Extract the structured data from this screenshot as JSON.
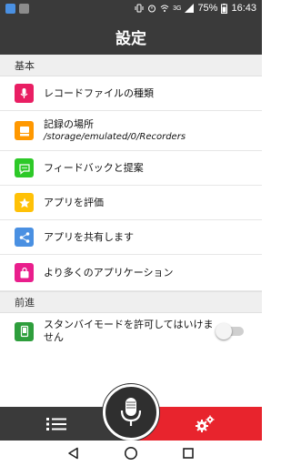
{
  "status_bar": {
    "network": "3G",
    "battery": "75%",
    "time": "16:43",
    "icons": [
      "notification-app-icon",
      "gallery-app-icon",
      "vibrate-icon",
      "alarm-icon",
      "wifi-icon",
      "signal-icon",
      "battery-icon"
    ]
  },
  "header": {
    "title": "設定"
  },
  "sections": [
    {
      "title": "基本",
      "items": [
        {
          "label": "レコードファイルの種類",
          "icon": "recorder-file-icon",
          "color": "#e91e63"
        },
        {
          "label": "記録の場所",
          "sub": "/storage/emulated/0/Recorders",
          "icon": "storage-drive-icon",
          "color": "#ff9800"
        },
        {
          "label": "フィードバックと提案",
          "icon": "chat-bubble-icon",
          "color": "#2dc928"
        },
        {
          "label": "アプリを評価",
          "icon": "star-icon",
          "color": "#ffc107"
        },
        {
          "label": "アプリを共有します",
          "icon": "share-icon",
          "color": "#4a90e2"
        },
        {
          "label": "より多くのアプリケーション",
          "icon": "shopping-bag-icon",
          "color": "#e91e8c"
        }
      ]
    },
    {
      "title": "前進",
      "items": [
        {
          "label": "スタンバイモードを許可してはいけません",
          "icon": "phone-screen-icon",
          "color": "#2e9e3c",
          "toggle": false
        }
      ]
    }
  ],
  "bottom_nav": {
    "left_icon": "list-icon",
    "center_icon": "microphone-icon",
    "right_icon": "gear-icon",
    "left_color": "#3a3a3a",
    "right_color": "#e8242d"
  },
  "system_nav": [
    "back-icon",
    "home-icon",
    "recents-icon"
  ]
}
